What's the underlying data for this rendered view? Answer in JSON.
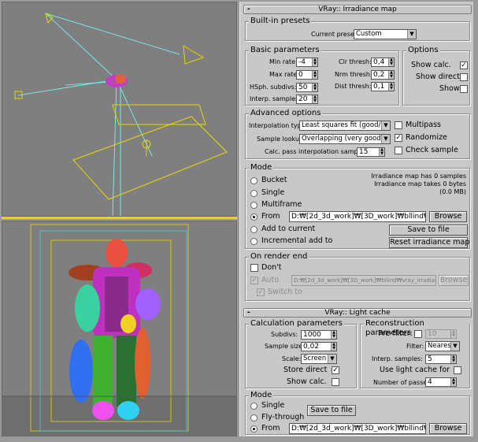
{
  "irradiance": {
    "title": "VRay:: Irradiance map",
    "sign": "-",
    "presets": {
      "group": "Built-in presets",
      "current_label": "Current preset:",
      "current_value": "Custom"
    },
    "basic": {
      "group": "Basic parameters",
      "min_rate_label": "Min rate:",
      "min_rate": "-4",
      "max_rate_label": "Max rate:",
      "max_rate": "0",
      "hsph_label": "HSph. subdivs:",
      "hsph": "50",
      "interp_label": "Interp. samples:",
      "interp": "20",
      "clr_label": "Clr thresh:",
      "clr": "0,4",
      "nrm_label": "Nrm thresh:",
      "nrm": "0,2",
      "dist_label": "Dist thresh:",
      "dist": "0,1"
    },
    "options": {
      "group": "Options",
      "show_calc": "Show calc.",
      "show_calc_checked": "✓",
      "show_direct": "Show direct",
      "show": "Show"
    },
    "advanced": {
      "group": "Advanced options",
      "interp_type_label": "Interpolation type:",
      "interp_type": "Least squares fit (good/smooth",
      "sample_lookup_label": "Sample lookup:",
      "sample_lookup": "Overlapping (very good/fast)",
      "calc_pass_label": "Calc. pass interpolation samples:",
      "calc_pass": "15",
      "multipass": "Multipass",
      "randomize": "Randomize",
      "randomize_checked": "✓",
      "check_sample": "Check sample"
    },
    "mode": {
      "group": "Mode",
      "bucket": "Bucket",
      "single": "Single",
      "multiframe": "Multiframe",
      "from": "From",
      "add_to_current": "Add to current",
      "incremental": "Incremental add to",
      "path": "D:₩[2d_3d_work]₩[3D_work]₩bllind₩",
      "browse": "Browse",
      "save_to_file": "Save to file",
      "reset": "Reset irradiance map",
      "info1": "Irradiance map has 0 samples",
      "info2": "Irradiance map takes 0 bytes",
      "info3": "(0.0 MB)"
    },
    "on_render_end": {
      "group": "On render end",
      "dont": "Don't",
      "auto": "Auto",
      "auto_checked": "✓",
      "path": "D:₩[2d_3d_work]₩[3D_work]₩bllind₩vray_irradiance₩ya",
      "browse": "Browse",
      "switch_to": "Switch to",
      "switch_checked": "✓"
    }
  },
  "light_cache": {
    "title": "VRay:: Light cache",
    "sign": "-",
    "calc": {
      "group": "Calculation parameters",
      "subdivs_label": "Subdivs:",
      "subdivs": "1000",
      "sample_size_label": "Sample size:",
      "sample_size": "0,02",
      "scale_label": "Scale:",
      "scale": "Screen",
      "store_direct": "Store direct",
      "store_direct_checked": "✓",
      "show_calc": "Show calc."
    },
    "recon": {
      "group": "Reconstruction parameters",
      "prefilter": "Pre-filter:",
      "prefilter_value": "10",
      "filter_label": "Filter:",
      "filter": "Nearest",
      "interp_label": "Interp. samples:",
      "interp": "5",
      "use_lc": "Use light cache for",
      "passes_label": "Number of passes:",
      "passes": "4"
    },
    "mode": {
      "group": "Mode",
      "single": "Single",
      "fly": "Fly-through",
      "from": "From",
      "save_to_file": "Save to file",
      "path": "D:₩[2d_3d_work]₩[3D_work]₩bllind₩",
      "browse": "Browse"
    }
  }
}
